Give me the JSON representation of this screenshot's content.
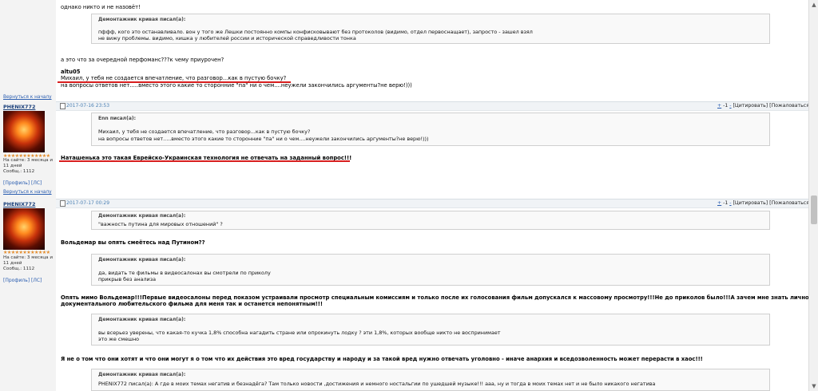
{
  "top_block": {
    "line1": "однако никто и не назовёт!",
    "quote_title": "Демонтажник кривая писал(а):",
    "quote_line1": "пффф, кого это останавливало. вон у того же Лешки постоянно компы конфисковывают без протоколов (видимо, отдел первоснащает), запросто - зашел взял",
    "quote_line2": "не вижу проблемы. видимо, кишка у любителей россии и исторической справедливости тонка",
    "line2": "а это что за очередной перфоманс???к чему приурочен?",
    "author": "altu05",
    "reply_line1": "Михаил, у тебя не создается впечатление, что разговор...как в пустую бочку?",
    "reply_line2": "на вопросы ответов нет.....вместо этого какие то сторонние  \"па\" ни о чем....неужели закончились аргументы?не верю!)))"
  },
  "posts": [
    {
      "back_link": "Вернуться к началу",
      "username": "PHENIX772",
      "date": "2017-07-16 23:53",
      "stars": "★★★★★★★★★★★★",
      "meta_line1": "На сайте: 3 месяца и",
      "meta_line2": "11 дней",
      "meta_line3": "Сообщ.: 1112",
      "profile": "[Профиль]",
      "ls": "[ЛС]",
      "actions": {
        "plus": "+",
        "score": "-1",
        "minus": "-",
        "quote": "[Цитировать]",
        "complain": "[Пожаловаться]"
      },
      "quote_title": "Enn писал(а):",
      "quote_line1": "Михаил, у тебя не создается впечатление, что разговор...как в пустую бочку?",
      "quote_line2": "на вопросы ответов нет.....вместо этого какие то сторонние  \"па\" ни о чем....неужели закончились аргументы?не верю!)))",
      "text": "Наташенька это такая Еврейско-Украинская технология не отвечать на заданный вопрос!!!"
    },
    {
      "back_link": "Вернуться к началу",
      "username": "PHENIX772",
      "date": "2017-07-17 00:29",
      "stars": "★★★★★★★★★★★★",
      "meta_line1": "На сайте: 3 месяца и",
      "meta_line2": "11 дней",
      "meta_line3": "Сообщ.: 1112",
      "profile": "[Профиль]",
      "ls": "[ЛС]",
      "actions": {
        "plus": "+",
        "score": "-1",
        "minus": "-",
        "quote": "[Цитировать]",
        "complain": "[Пожаловаться]"
      },
      "q1_title": "Демонтажник кривая писал(а):",
      "q1_line": "\"важность путина для мировых отношений\" ?",
      "t1": "Вольдемар вы опять смеётесь над Путином??",
      "q2_title": "Демонтажник кривая писал(а):",
      "q2_line1": "да, видать те фильмы в видеосалонах вы смотрели по приколу",
      "q2_line2": "прикрыв без анализа",
      "t2_line1": "Опять мимо Вольдемар!!!Первые видеосалоны перед показом устраивали просмотр специальным комиссиям и только после их голосования фильм допускался к массовому просмотру!!!Не до приколов было!!!А зачем мне знать личность режиссёра",
      "t2_line2": "документального любительского фильма для меня так и останется непонятным!!!",
      "q3_title": "Демонтажник кривая писал(а):",
      "q3_line1": "вы всерьез уверены, что какая-то кучка 1,8% способна нагадить стране или опрокинуть лодку ? эти 1,8%, которых вообще никто не воспринимает",
      "q3_line2": "это же смешно",
      "t3": "Я не о том что они хотят и что они могут я о том что их действия это вред государству и народу и за такой вред нужно отвечать уголовно - иначе анархия и вседозволенность может перерасти в хаос!!!",
      "q4_title": "Демонтажник кривая писал(а):",
      "q4_line": "PHENIX772 писал(а): А где в моих темах негатив и безнадёга? Там только новости ,достижения и немного ностальгии по ушедшей музыке!!! ааа, ну и тогда в моих темах нет и не было никакого негатива"
    }
  ],
  "scrollbar": {
    "up": "▲",
    "down": "▼"
  }
}
